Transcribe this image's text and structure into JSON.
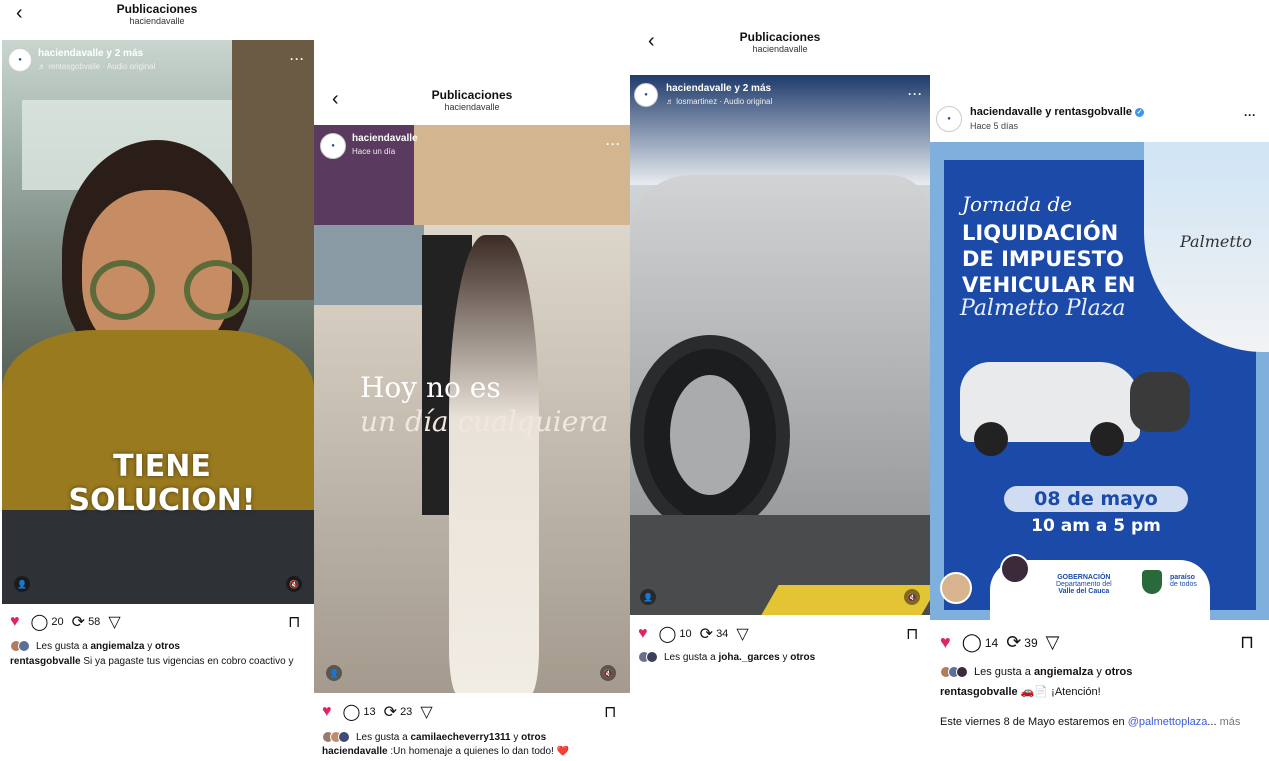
{
  "panels": [
    {
      "header_title": "Publicaciones",
      "header_sub": "haciendavalle",
      "overlay_user": "haciendavalle y 2 más",
      "overlay_sub": "♬ rentasgobvalle · Audio original",
      "overlay_text": [
        "TIENE",
        "SOLUCION!"
      ],
      "comments": "20",
      "reposts": "58",
      "likes_text": "Les gusta a",
      "likes_user": "angiemalza",
      "likes_rest": "y",
      "likes_others": "otros",
      "caption_user": "rentasgobvalle",
      "caption_text": "Si ya pagaste tus vigencias en cobro coactivo y"
    },
    {
      "header_title": "Publicaciones",
      "header_sub": "haciendavalle",
      "overlay_user": "haciendavalle",
      "overlay_sub": "Hace un día",
      "overlay_text_1": "Hoy no es",
      "overlay_text_2": "un día cualquiera",
      "comments": "13",
      "reposts": "23",
      "likes_text": "Les gusta a",
      "likes_user": "camilaecheverry1311",
      "likes_rest": "y",
      "likes_others": "otros",
      "caption_user": "haciendavalle",
      "caption_text": ":Un homenaje a quienes lo dan todo! ❤️"
    },
    {
      "header_title": "Publicaciones",
      "header_sub": "haciendavalle",
      "overlay_user": "haciendavalle y 2 más",
      "overlay_sub": "♬ losmartinez · Audio original",
      "comments": "10",
      "reposts": "34",
      "likes_text": "Les gusta a",
      "likes_user": "joha._garces",
      "likes_rest": "y",
      "likes_others": "otros"
    },
    {
      "post_user": "haciendavalle y rentasgobvalle",
      "post_time": "Hace 5 días",
      "poster": {
        "script_line": "Jornada de",
        "lines": [
          "LIQUIDACIÓN",
          "DE IMPUESTO",
          "VEHICULAR EN"
        ],
        "script_line_2": "Palmetto Plaza",
        "date": "08 de mayo",
        "hours": "10 am a 5 pm",
        "gob_title": "GOBERNACIÓN",
        "gob_sub1": "Departamento del",
        "gob_sub2": "Valle del Cauca",
        "paraiso_1": "paraíso",
        "paraiso_2": "de todos",
        "mall_sign": "Palmetto"
      },
      "comments": "14",
      "reposts": "39",
      "likes_text": "Les gusta a",
      "likes_user": "angiemalza",
      "likes_rest": "y",
      "likes_others": "otros",
      "caption_user": "rentasgobvalle",
      "caption_text": "🚗📄 ¡Atención!",
      "caption_line2": "Este viernes 8 de Mayo estaremos en",
      "caption_mention": "@palmettoplaza",
      "caption_more_dots": "...",
      "caption_more": "más"
    }
  ],
  "colors": {
    "heart": "#e0245e",
    "poster_blue": "#1b4aa8",
    "mention": "#3b5bdb"
  }
}
